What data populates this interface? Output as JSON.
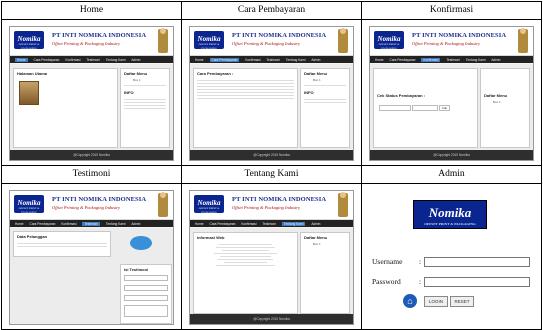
{
  "headers": [
    "Home",
    "Cara Pembayaran",
    "Konfirmasi",
    "Testimoni",
    "Tentang Kami",
    "Admin"
  ],
  "site": {
    "logo": "Nomika",
    "logo_sub": "OFFSET PRINT & PACKAGING",
    "company": "PT INTI NOMIKA INDONESIA",
    "tagline": "Offset Printing & Packaging Industry",
    "nav": [
      "Home",
      "Cara Pembayaran",
      "Konfirmasi",
      "Testimoni",
      "Tentang Kami",
      "Admin"
    ],
    "footer": "@Copyright 2015 Nomika"
  },
  "home": {
    "title": "Halaman Utama",
    "side_title": "Daftar Menu",
    "side_item": "Box 1",
    "info_title": "INFO"
  },
  "cara": {
    "title": "Cara Pembayaran :",
    "side_title": "Daftar Menu",
    "side_item": "Box 1",
    "info_title": "INFO"
  },
  "konfirmasi": {
    "title": "Cek Status Pembayaran :",
    "side_title": "Daftar Menu",
    "side_item": "Box 1",
    "button": "Cek"
  },
  "testimoni": {
    "title": "Data Pelanggan",
    "form_title": "Isi Testimoni"
  },
  "tentang": {
    "title": "Informasi Web",
    "side_title": "Daftar Menu",
    "side_item": "Box 1"
  },
  "admin": {
    "logo": "Nomika",
    "logo_sub": "OFFSET PRINT & PACKAGING",
    "username_label": "Username",
    "password_label": "Password",
    "colon": ":",
    "login_button": "LOGIN",
    "reset_button": "RESET",
    "home_icon": "home-icon"
  }
}
